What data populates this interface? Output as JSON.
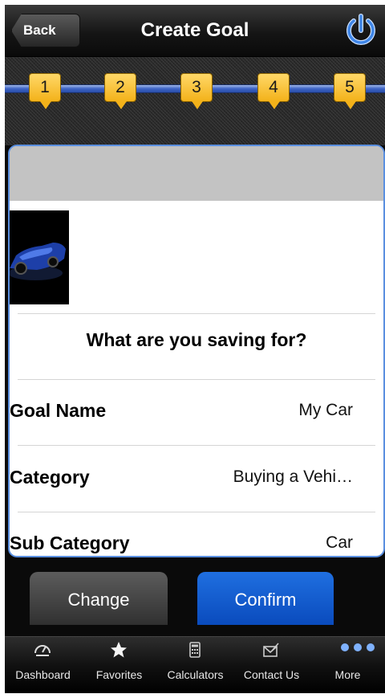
{
  "header": {
    "back_label": "Back",
    "title": "Create Goal",
    "power_icon": "power-icon"
  },
  "steps": [
    "1",
    "2",
    "3",
    "4",
    "5"
  ],
  "form": {
    "question": "What are you saving for?",
    "rows": [
      {
        "label": "Goal Name",
        "value": "My Car"
      },
      {
        "label": "Category",
        "value": "Buying a Vehi…"
      },
      {
        "label": "Sub Category",
        "value": "Car"
      }
    ]
  },
  "actions": {
    "change_label": "Change",
    "confirm_label": "Confirm"
  },
  "tabs": [
    {
      "label": "Dashboard",
      "icon": "speedometer-icon"
    },
    {
      "label": "Favorites",
      "icon": "star-icon"
    },
    {
      "label": "Calculators",
      "icon": "calculator-icon"
    },
    {
      "label": "Contact Us",
      "icon": "envelope-icon"
    },
    {
      "label": "More",
      "icon": "more-dots-icon"
    }
  ],
  "colors": {
    "accent_blue": "#0a4bbd",
    "step_badge": "#f3b21a",
    "card_header": "#c3c3c3",
    "card_border": "#5a8fe0"
  }
}
